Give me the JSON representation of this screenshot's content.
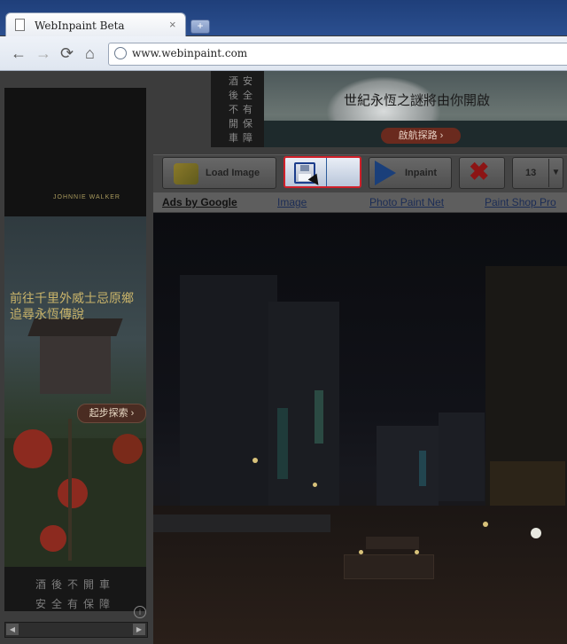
{
  "browser": {
    "tab_title": "WebInpaint Beta",
    "tab_close_glyph": "×",
    "new_tab_glyph": "+",
    "url": "www.webinpaint.com",
    "nav_icons": {
      "back": "←",
      "forward": "→",
      "reload": "⟳",
      "home": "⌂"
    }
  },
  "ads": {
    "left_brand": "JOHNNIE WALKER",
    "left_headline": "前往千里外威士忌原鄉\n追尋永恆傳說",
    "left_cta": "起步探索 ›",
    "left_slogan_1": "酒後不開車",
    "left_slogan_2": "安全有保障",
    "left_info_glyph": "i",
    "banner_poem_col1": "酒後不開車",
    "banner_poem_col2": "安全有保障",
    "banner_headline": "世紀永恆之謎將由你開啟",
    "banner_cta": "啟航探路 ›"
  },
  "toolbar": {
    "load_label": "Load Image",
    "inpaint_label": "Inpaint",
    "delete_glyph": "✖",
    "brush_size": "13",
    "dropdown_glyph": "▼"
  },
  "adlinks": {
    "ads_by_google": "Ads by Google",
    "link1": "Image",
    "link2": "Photo Paint Net",
    "link3": "Paint Shop Pro"
  },
  "scrollbar": {
    "left_glyph": "◀",
    "right_glyph": "▶"
  },
  "colors": {
    "accent_red": "#d0202a",
    "chrome_blue": "#2b4f8f",
    "ad_gold": "#c9b36a"
  },
  "icons": {
    "load": "folder-open-icon",
    "save": "floppy-disk-icon",
    "inpaint": "play-triangle-icon",
    "delete": "red-x-icon"
  }
}
